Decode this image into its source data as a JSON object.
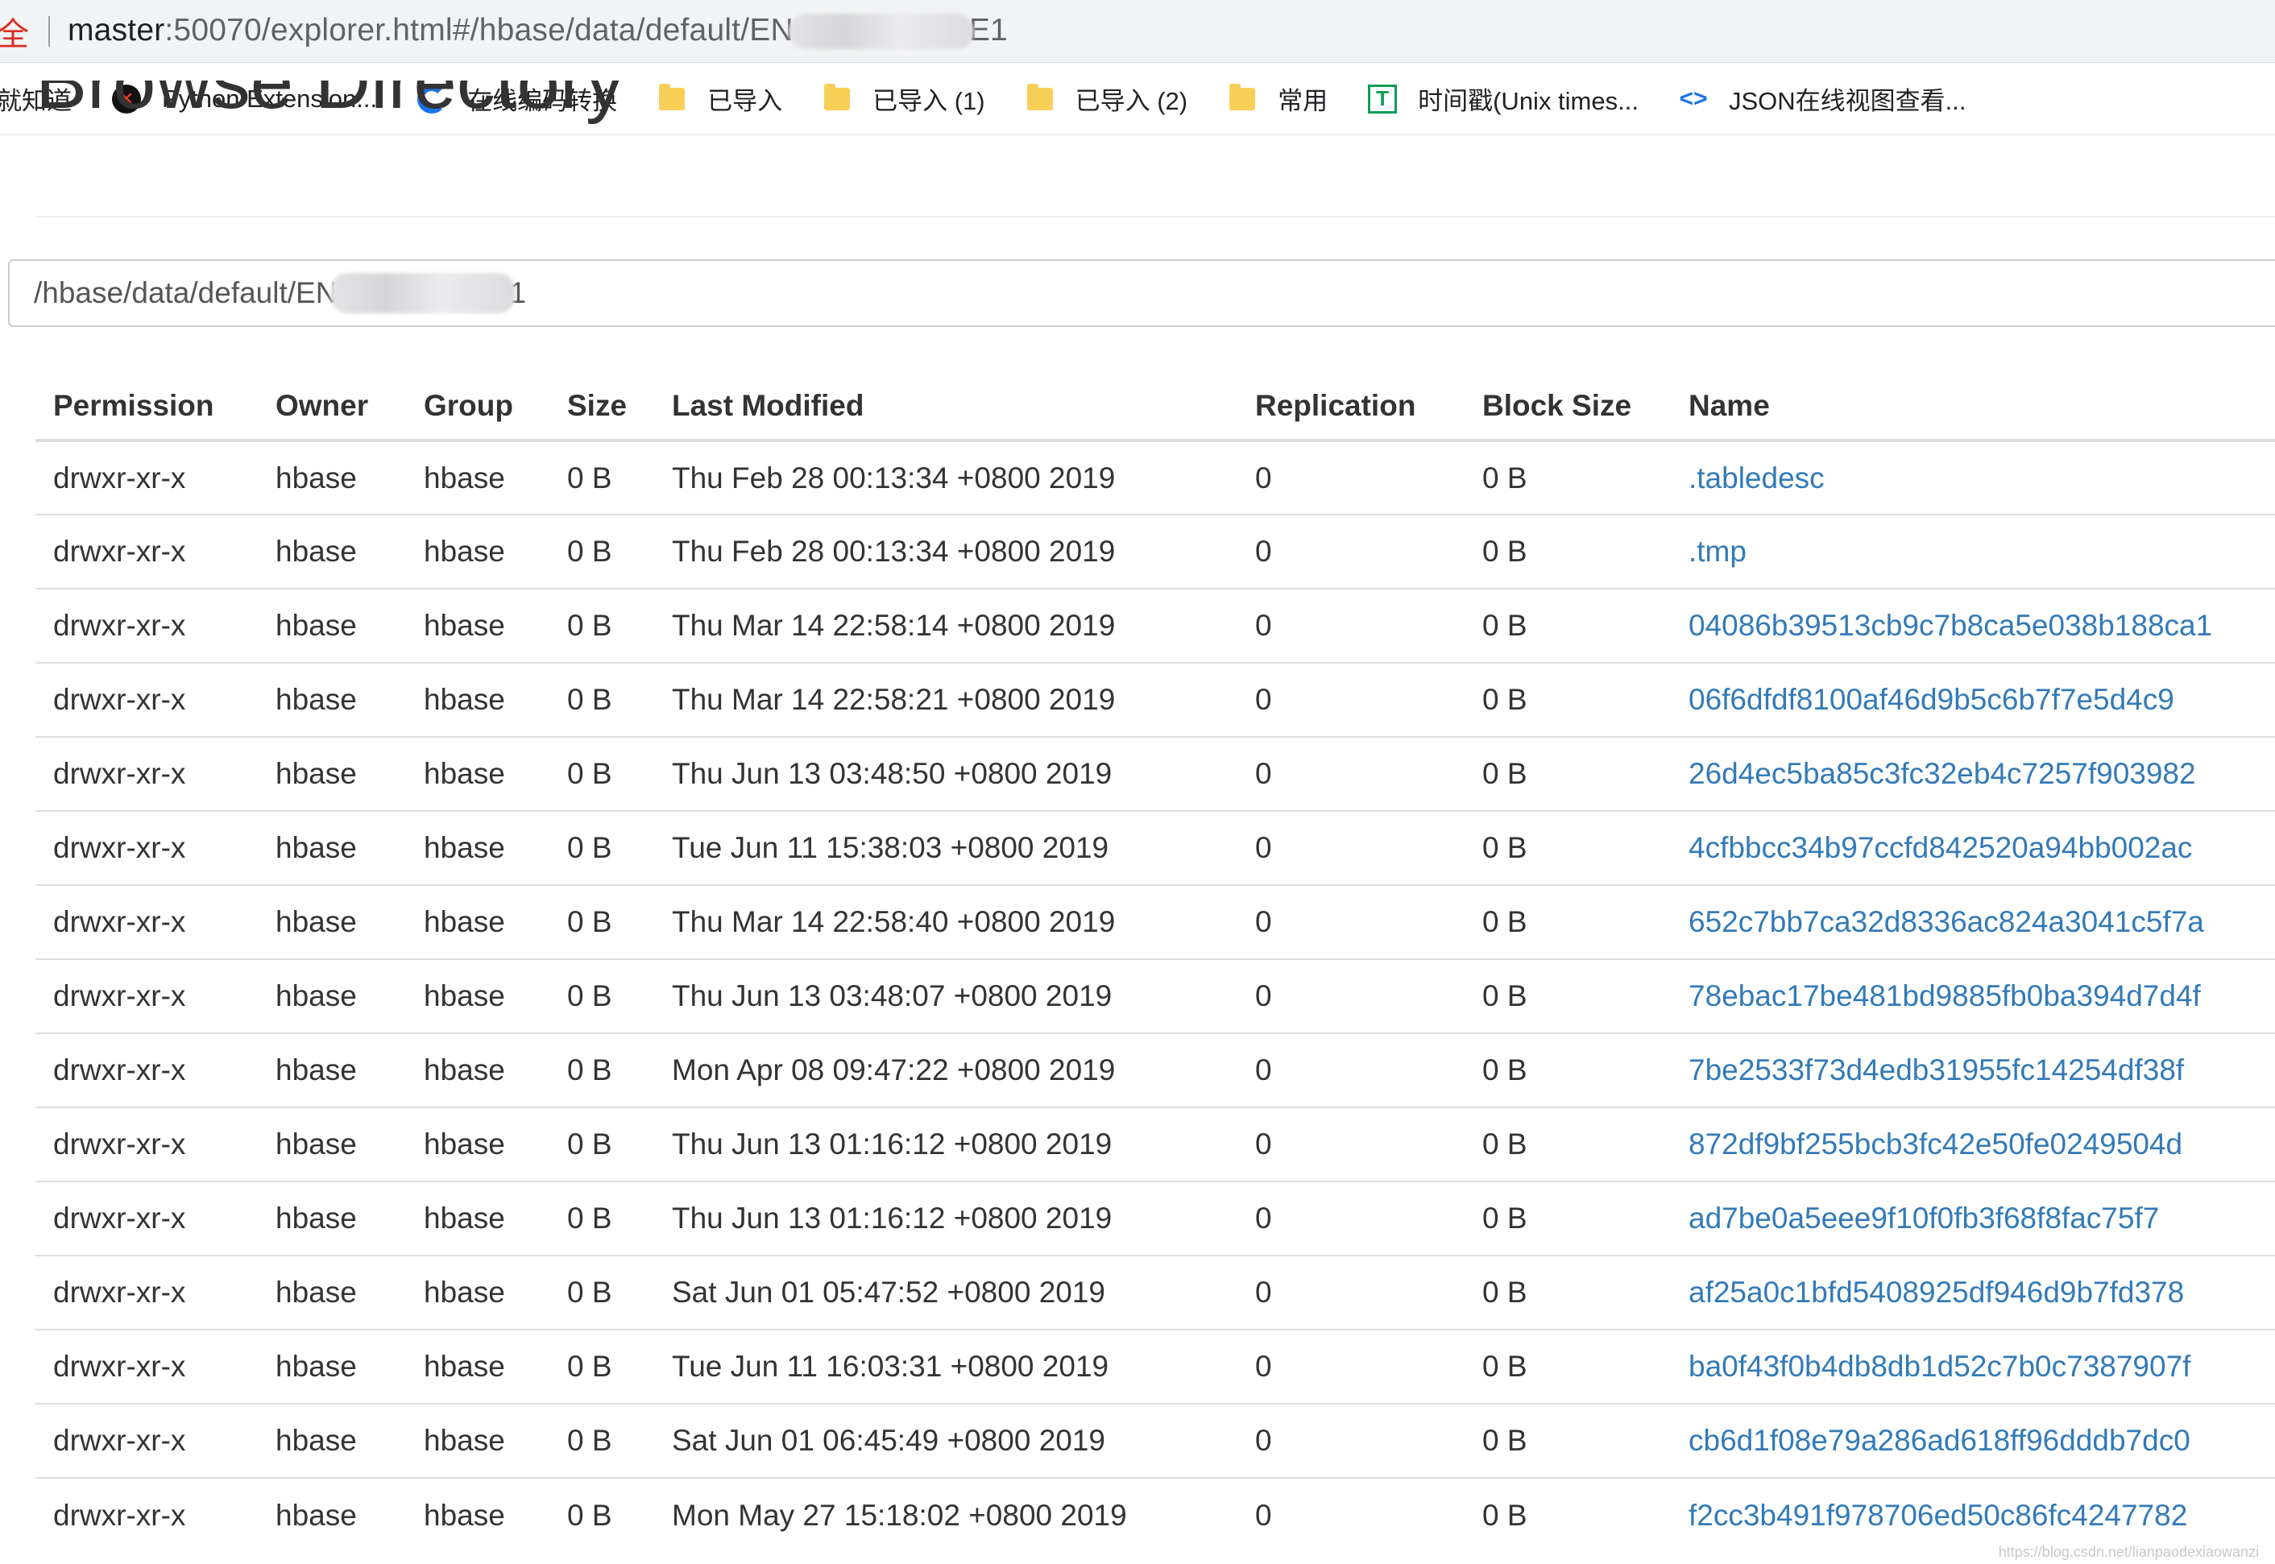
{
  "browser": {
    "secure_label": "全",
    "url_host": "master",
    "url_prefix": ":50070/explorer.html#/hbase/data/default/EN",
    "url_suffix": "E1"
  },
  "bookmarks": [
    {
      "label": "就知道",
      "icon": "none"
    },
    {
      "label": "Python Extension...",
      "icon": "python-icon"
    },
    {
      "label": "在线编码转换",
      "icon": "convert-icon"
    },
    {
      "label": "已导入",
      "icon": "folder-icon"
    },
    {
      "label": "已导入 (1)",
      "icon": "folder-icon"
    },
    {
      "label": "已导入 (2)",
      "icon": "folder-icon"
    },
    {
      "label": "常用",
      "icon": "folder-icon"
    },
    {
      "label": "时间戳(Unix times...",
      "icon": "timestamp-icon"
    },
    {
      "label": "JSON在线视图查看...",
      "icon": "json-icon"
    }
  ],
  "page": {
    "title": "Browse Directory",
    "path_prefix": "/hbase/data/default/EN",
    "path_suffix": "1"
  },
  "table": {
    "headers": [
      "Permission",
      "Owner",
      "Group",
      "Size",
      "Last Modified",
      "Replication",
      "Block Size",
      "Name"
    ],
    "rows": [
      [
        "drwxr-xr-x",
        "hbase",
        "hbase",
        "0 B",
        "Thu Feb 28 00:13:34 +0800 2019",
        "0",
        "0 B",
        ".tabledesc"
      ],
      [
        "drwxr-xr-x",
        "hbase",
        "hbase",
        "0 B",
        "Thu Feb 28 00:13:34 +0800 2019",
        "0",
        "0 B",
        ".tmp"
      ],
      [
        "drwxr-xr-x",
        "hbase",
        "hbase",
        "0 B",
        "Thu Mar 14 22:58:14 +0800 2019",
        "0",
        "0 B",
        "04086b39513cb9c7b8ca5e038b188ca1"
      ],
      [
        "drwxr-xr-x",
        "hbase",
        "hbase",
        "0 B",
        "Thu Mar 14 22:58:21 +0800 2019",
        "0",
        "0 B",
        "06f6dfdf8100af46d9b5c6b7f7e5d4c9"
      ],
      [
        "drwxr-xr-x",
        "hbase",
        "hbase",
        "0 B",
        "Thu Jun 13 03:48:50 +0800 2019",
        "0",
        "0 B",
        "26d4ec5ba85c3fc32eb4c7257f903982"
      ],
      [
        "drwxr-xr-x",
        "hbase",
        "hbase",
        "0 B",
        "Tue Jun 11 15:38:03 +0800 2019",
        "0",
        "0 B",
        "4cfbbcc34b97ccfd842520a94bb002ac"
      ],
      [
        "drwxr-xr-x",
        "hbase",
        "hbase",
        "0 B",
        "Thu Mar 14 22:58:40 +0800 2019",
        "0",
        "0 B",
        "652c7bb7ca32d8336ac824a3041c5f7a"
      ],
      [
        "drwxr-xr-x",
        "hbase",
        "hbase",
        "0 B",
        "Thu Jun 13 03:48:07 +0800 2019",
        "0",
        "0 B",
        "78ebac17be481bd9885fb0ba394d7d4f"
      ],
      [
        "drwxr-xr-x",
        "hbase",
        "hbase",
        "0 B",
        "Mon Apr 08 09:47:22 +0800 2019",
        "0",
        "0 B",
        "7be2533f73d4edb31955fc14254df38f"
      ],
      [
        "drwxr-xr-x",
        "hbase",
        "hbase",
        "0 B",
        "Thu Jun 13 01:16:12 +0800 2019",
        "0",
        "0 B",
        "872df9bf255bcb3fc42e50fe0249504d"
      ],
      [
        "drwxr-xr-x",
        "hbase",
        "hbase",
        "0 B",
        "Thu Jun 13 01:16:12 +0800 2019",
        "0",
        "0 B",
        "ad7be0a5eee9f10f0fb3f68f8fac75f7"
      ],
      [
        "drwxr-xr-x",
        "hbase",
        "hbase",
        "0 B",
        "Sat Jun 01 05:47:52 +0800 2019",
        "0",
        "0 B",
        "af25a0c1bfd5408925df946d9b7fd378"
      ],
      [
        "drwxr-xr-x",
        "hbase",
        "hbase",
        "0 B",
        "Tue Jun 11 16:03:31 +0800 2019",
        "0",
        "0 B",
        "ba0f43f0b4db8db1d52c7b0c7387907f"
      ],
      [
        "drwxr-xr-x",
        "hbase",
        "hbase",
        "0 B",
        "Sat Jun 01 06:45:49 +0800 2019",
        "0",
        "0 B",
        "cb6d1f08e79a286ad618ff96dddb7dc0"
      ],
      [
        "drwxr-xr-x",
        "hbase",
        "hbase",
        "0 B",
        "Mon May 27 15:18:02 +0800 2019",
        "0",
        "0 B",
        "f2cc3b491f978706ed50c86fc4247782"
      ]
    ]
  },
  "watermark": "https://blog.csdn.net/lianpaodexiaowanzi"
}
